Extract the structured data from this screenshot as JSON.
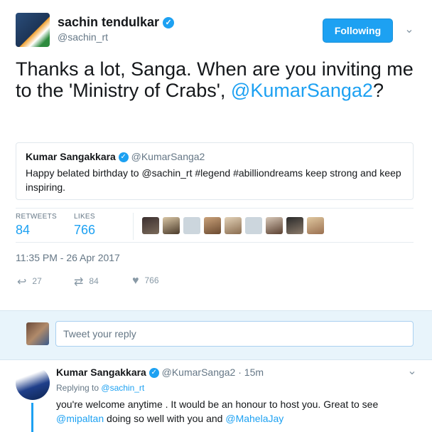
{
  "author": {
    "name": "sachin tendulkar",
    "handle": "@sachin_rt",
    "follow_label": "Following"
  },
  "tweet": {
    "text_before": "Thanks a lot, Sanga. When are you inviting me to the 'Ministry of Crabs',",
    "mention": "@KumarSanga2",
    "text_after": "?"
  },
  "quoted": {
    "name": "Kumar Sangakkara",
    "handle": "@KumarSanga2",
    "text": "Happy belated birthday to @sachin_rt #legend #abilliondreams keep strong and keep inspiring."
  },
  "stats": {
    "retweets_label": "RETWEETS",
    "retweets": "84",
    "likes_label": "LIKES",
    "likes": "766"
  },
  "timestamp": "11:35 PM - 26 Apr 2017",
  "actions": {
    "reply_count": "27",
    "retweet_count": "84",
    "like_count": "766"
  },
  "reply_box": {
    "placeholder": "Tweet your reply"
  },
  "reply": {
    "name": "Kumar Sangakkara",
    "handle": "@KumarSanga2",
    "separator": "·",
    "time": "15m",
    "replying_to_label": "Replying to",
    "replying_to_handle": "@sachin_rt",
    "text_1": "you're welcome anytime . It would be an honour to host you. Great to see",
    "mention_1": "@mipaltan",
    "text_2": "doing so well with you and",
    "mention_2": "@MahelaJay"
  },
  "colors": {
    "accent": "#1da1f2",
    "reply_bg": "#e8f4fb"
  }
}
